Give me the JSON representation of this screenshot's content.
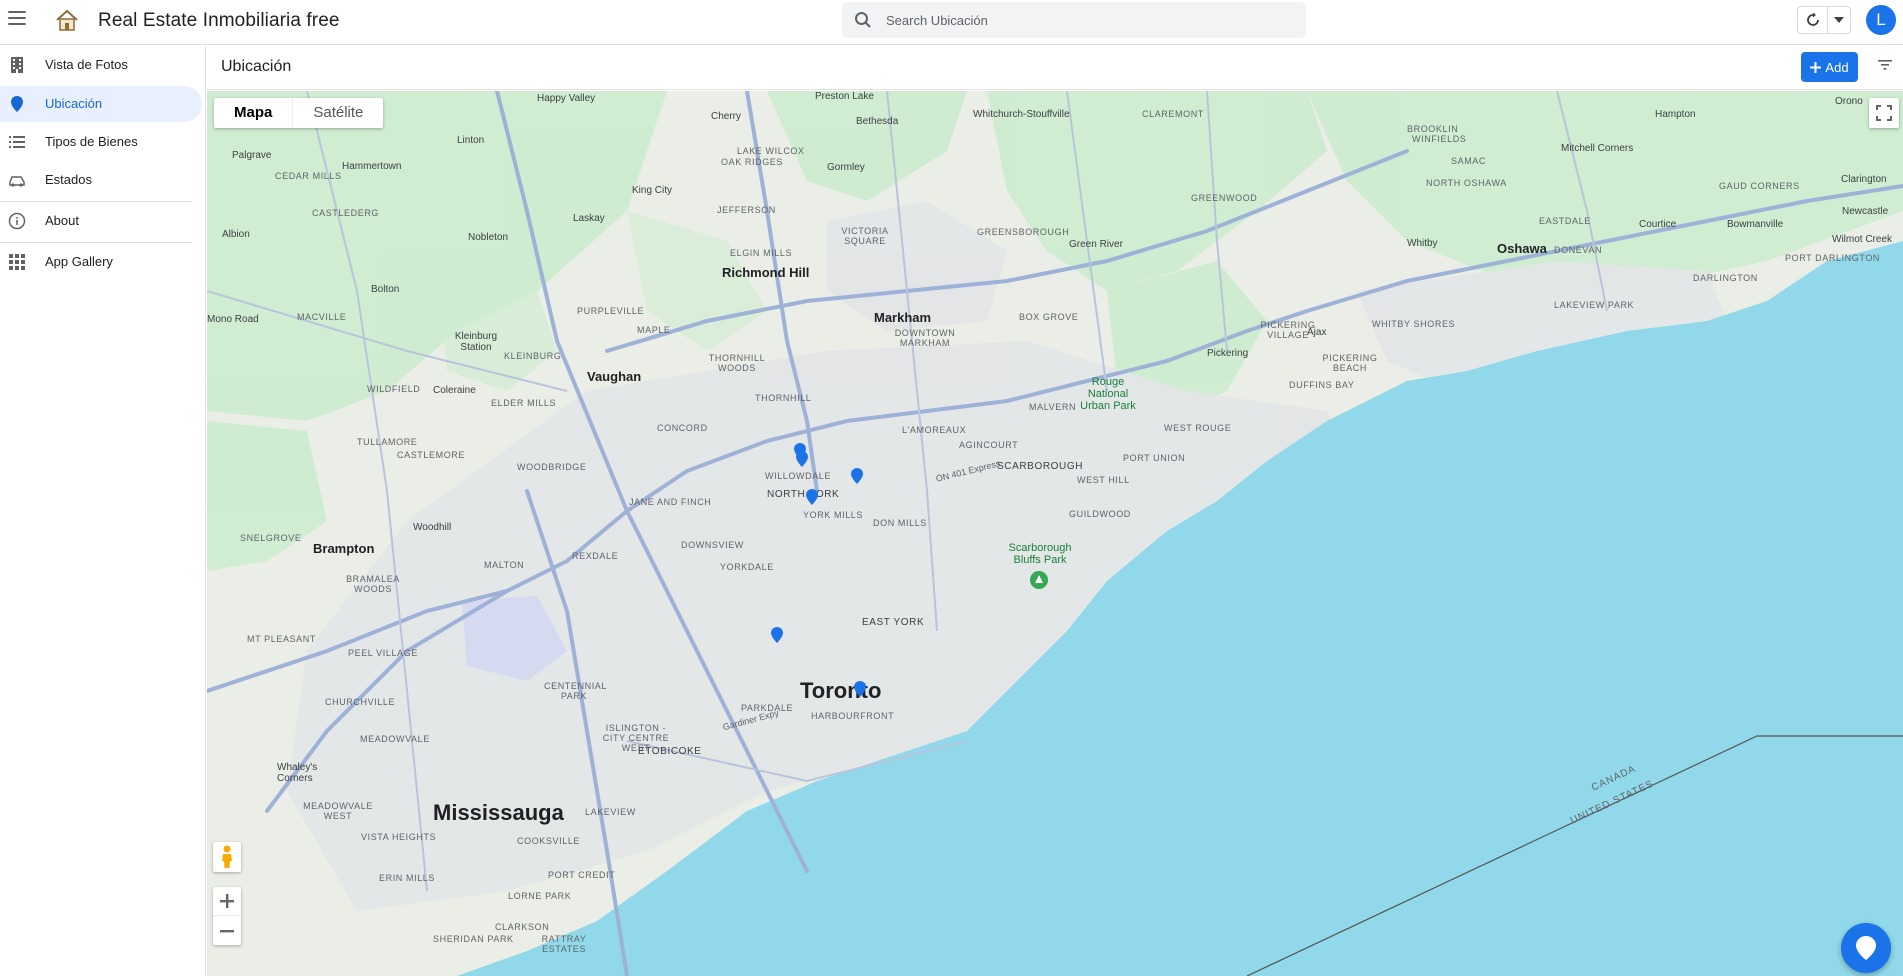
{
  "app": {
    "title": "Real Estate Inmobiliaria free",
    "user_initial": "L"
  },
  "search": {
    "placeholder": "Search Ubicación",
    "value": ""
  },
  "sidebar": {
    "items": [
      {
        "label": "Vista de Fotos",
        "icon": "building-icon"
      },
      {
        "label": "Ubicación",
        "icon": "location-pin-icon",
        "active": true
      },
      {
        "label": "Tipos de Bienes",
        "icon": "list-icon"
      },
      {
        "label": "Estados",
        "icon": "status-car-icon"
      },
      {
        "label": "About",
        "icon": "info-icon"
      },
      {
        "label": "App Gallery",
        "icon": "apps-grid-icon"
      }
    ]
  },
  "content": {
    "page_title": "Ubicación",
    "add_label": "Add"
  },
  "map": {
    "type_map": "Mapa",
    "type_satellite": "Satélite",
    "selected_type": "Mapa",
    "labels": {
      "happy_valley": "Happy Valley",
      "preston_lake": "Preston Lake",
      "cherry": "Cherry",
      "bethesda": "Bethesda",
      "whitchurch": "Whitchurch-Stouffville",
      "claremont": "CLAREMONT",
      "brooklin": "BROOKLIN",
      "hampton": "Hampton",
      "orono": "Orono",
      "palgrave": "Palgrave",
      "linton": "Linton",
      "lake_wilcox": "LAKE WILCOX",
      "oak_ridges": "OAK RIDGES",
      "gormley": "Gormley",
      "winfields": "WINFIELDS",
      "mitchell_corners": "Mitchell Corners",
      "samac": "SAMAC",
      "cedar_mills": "CEDAR MILLS",
      "hammertown": "Hammertown",
      "king_city": "King City",
      "north_oshawa": "NORTH OSHAWA",
      "gaud_corners": "GAUD CORNERS",
      "clarington": "Clarington",
      "castlederg": "CASTLEDERG",
      "jefferson": "JEFFERSON",
      "laskay": "Laskay",
      "victoria_square": "VICTORIA SQUARE",
      "greenwood": "GREENWOOD",
      "eastdale": "EASTDALE",
      "courtice": "Courtice",
      "bowmanville": "Bowmanville",
      "newcastle": "Newcastle",
      "albion": "Albion",
      "nobleton": "Nobleton",
      "greensborough": "GREENSBOROUGH",
      "green_river": "Green River",
      "whitby": "Whitby",
      "oshawa": "Oshawa",
      "donevan": "DONEVAN",
      "wilmot_creek": "Wilmot Creek",
      "elgin_mills": "ELGIN MILLS",
      "port_darlington": "PORT DARLINGTON",
      "richmond_hill": "Richmond Hill",
      "darlington": "DARLINGTON",
      "bolton": "Bolton",
      "markham": "Markham",
      "purpleville": "PURPLEVILLE",
      "mono_road": "Mono Road",
      "macville": "MACVILLE",
      "maple": "MAPLE",
      "downtown_markham": "DOWNTOWN MARKHAM",
      "box_grove": "BOX GROVE",
      "pickering_village": "PICKERING VILLAGE",
      "ajax": "Ajax",
      "whitby_shores": "WHITBY SHORES",
      "lakeview_park": "LAKEVIEW PARK",
      "kleinburg": "Kleinburg Station",
      "kleinburg_village": "KLEINBURG",
      "thornhill_woods": "THORNHILL WOODS",
      "pickering": "Pickering",
      "pickering_beach": "PICKERING BEACH",
      "wildfield": "WILDFIELD",
      "coleraine": "Coleraine",
      "vaughan": "Vaughan",
      "duffins_bay": "DUFFINS BAY",
      "elder_mills": "ELDER MILLS",
      "thornhill": "THORNHILL",
      "rouge_park": "Rouge National Urban Park",
      "malvern": "MALVERN",
      "concord": "CONCORD",
      "lamoreaux": "L'AMOREAUX",
      "west_rouge": "WEST ROUGE",
      "tullamore": "TULLAMORE",
      "agincourt": "AGINCOURT",
      "castlemore": "CASTLEMORE",
      "port_union": "PORT UNION",
      "woodbridge": "WOODBRIDGE",
      "scarborough": "SCARBOROUGH",
      "willowdale": "WILLOWDALE",
      "west_hill": "WEST HILL",
      "north_york": "NORTH YORK",
      "jane_finch": "JANE AND FINCH",
      "guildwood": "GUILDWOOD",
      "york_mills": "YORK MILLS",
      "snelgrove": "SNELGROVE",
      "woodhill": "Woodhill",
      "don_mills": "DON MILLS",
      "scarborough_bluffs": "Scarborough Bluffs Park",
      "brampton": "Brampton",
      "downsview": "DOWNSVIEW",
      "rexdale": "REXDALE",
      "yorkdale": "YORKDALE",
      "malton": "MALTON",
      "bramalea": "BRAMALEA WOODS",
      "east_york": "EAST YORK",
      "mt_pleasant": "MT PLEASANT",
      "peel_village": "PEEL VILLAGE",
      "centennial_park": "CENTENNIAL PARK",
      "toronto": "Toronto",
      "churchville": "CHURCHVILLE",
      "parkdale": "PARKDALE",
      "islington": "ISLINGTON - CITY CENTRE WEST",
      "harbourfront": "HARBOURFRONT",
      "meadowvale": "MEADOWVALE",
      "etobicoke": "ETOBICOKE",
      "whaleys_corners": "Whaley's Corners",
      "mississauga": "Mississauga",
      "meadowvale_west": "MEADOWVALE WEST",
      "lakeview": "LAKEVIEW",
      "vista_heights": "VISTA HEIGHTS",
      "cooksville": "COOKSVILLE",
      "port_credit": "PORT CREDIT",
      "erin_mills": "ERIN MILLS",
      "lorne_park": "LORNE PARK",
      "clarkson": "CLARKSON",
      "sheridan_park": "SHERIDAN PARK",
      "rattray": "RATTRAY ESTATES",
      "canada": "CANADA",
      "united_states": "UNITED STATES",
      "gardiner": "Gardiner Expy",
      "on401": "ON 401 Express"
    }
  }
}
